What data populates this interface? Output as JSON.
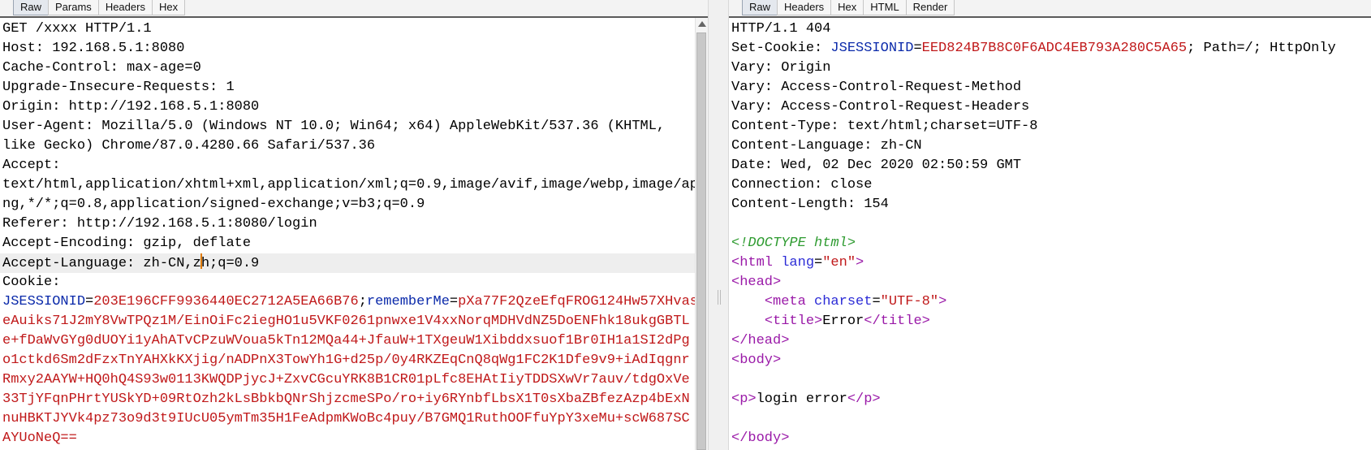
{
  "request": {
    "tabs": [
      "Raw",
      "Params",
      "Headers",
      "Hex"
    ],
    "active_tab": "Raw",
    "lines": [
      "GET /xxxx HTTP/1.1",
      "Host: 192.168.5.1:8080",
      "Cache-Control: max-age=0",
      "Upgrade-Insecure-Requests: 1",
      "Origin: http://192.168.5.1:8080",
      "User-Agent: Mozilla/5.0 (Windows NT 10.0; Win64; x64) AppleWebKit/537.36 (KHTML,",
      "like Gecko) Chrome/87.0.4280.66 Safari/537.36",
      "Accept:",
      "text/html,application/xhtml+xml,application/xml;q=0.9,image/avif,image/webp,image/ap",
      "ng,*/*;q=0.8,application/signed-exchange;v=b3;q=0.9",
      "Referer: http://192.168.5.1:8080/login",
      "Accept-Encoding: gzip, deflate"
    ],
    "accept_language_before_caret": "Accept-Language: zh-CN,z",
    "accept_language_after_caret": "h;q=0.9",
    "cookie_label": "Cookie:",
    "cookie_name_1": "JSESSIONID",
    "cookie_eq_1": "=",
    "cookie_value_1": "203E196CFF9936440EC2712A5EA66B76",
    "cookie_sep": ";",
    "cookie_name_2": "rememberMe",
    "cookie_eq_2": "=",
    "cookie_value_2_lines": [
      "pXa77F2QzeEfqFROG124Hw57XHvas",
      "eAuiks71J2mY8VwTPQz1M/EinOiFc2iegHO1u5VKF0261pnwxe1V4xxNorqMDHVdNZ5DoENFhk18ukgGBTL",
      "e+fDaWvGYg0dUOYi1yAhATvCPzuWVoua5kTn12MQa44+JfauW+1TXgeuW1Xibddxsuof1Br0IH1a1SI2dPg",
      "o1ctkd6Sm2dFzxTnYAHXkKXjig/nADPnX3TowYh1G+d25p/0y4RKZEqCnQ8qWg1FC2K1Dfe9v9+iAdIqgnr",
      "Rmxy2AAYW+HQ0hQ4S93w0113KWQDPjycJ+ZxvCGcuYRK8B1CR01pLfc8EHAtIiyTDDSXwVr7auv/tdgOxVe",
      "33TjYFqnPHrtYUSkYD+09RtOzh2kLsBbkbQNrShjzcmeSPo/ro+iy6RYnbfLbsX1T0sXbaZBfezAzp4bExN",
      "nuHBKTJYVk4pz73o9d3t9IUcU05ymTm35H1FeAdpmKWoBc4puy/B7GMQ1RuthOOFfuYpY3xeMu+scW687SC",
      "AYUoNeQ=="
    ]
  },
  "response": {
    "tabs": [
      "Raw",
      "Headers",
      "Hex",
      "HTML",
      "Render"
    ],
    "active_tab": "Raw",
    "status_line": "HTTP/1.1 404",
    "set_cookie_label": "Set-Cookie: ",
    "set_cookie_name": "JSESSIONID",
    "set_cookie_eq": "=",
    "set_cookie_value": "EED824B7B8C0F6ADC4EB793A280C5A65",
    "set_cookie_rest": "; Path=/; HttpOnly",
    "headers": [
      "Vary: Origin",
      "Vary: Access-Control-Request-Method",
      "Vary: Access-Control-Request-Headers",
      "Content-Type: text/html;charset=UTF-8",
      "Content-Language: zh-CN",
      "Date: Wed, 02 Dec 2020 02:50:59 GMT",
      "Connection: close",
      "Content-Length: 154"
    ],
    "body": {
      "doctype": "<!DOCTYPE html>",
      "html_open": "<html",
      "lang_attr": "lang",
      "lang_eq": "=",
      "lang_value": "\"en\"",
      "html_close_bracket": ">",
      "head_open": "<head>",
      "meta_open": "<meta",
      "charset_attr": "charset",
      "charset_eq": "=",
      "charset_value": "\"UTF-8\"",
      "meta_close": ">",
      "title_open": "<title>",
      "title_text": "Error",
      "title_close": "</title>",
      "head_close": "</head>",
      "body_open": "<body>",
      "p_open": "<p>",
      "p_text": "login error",
      "p_close": "</p>",
      "body_close": "</body>"
    }
  }
}
